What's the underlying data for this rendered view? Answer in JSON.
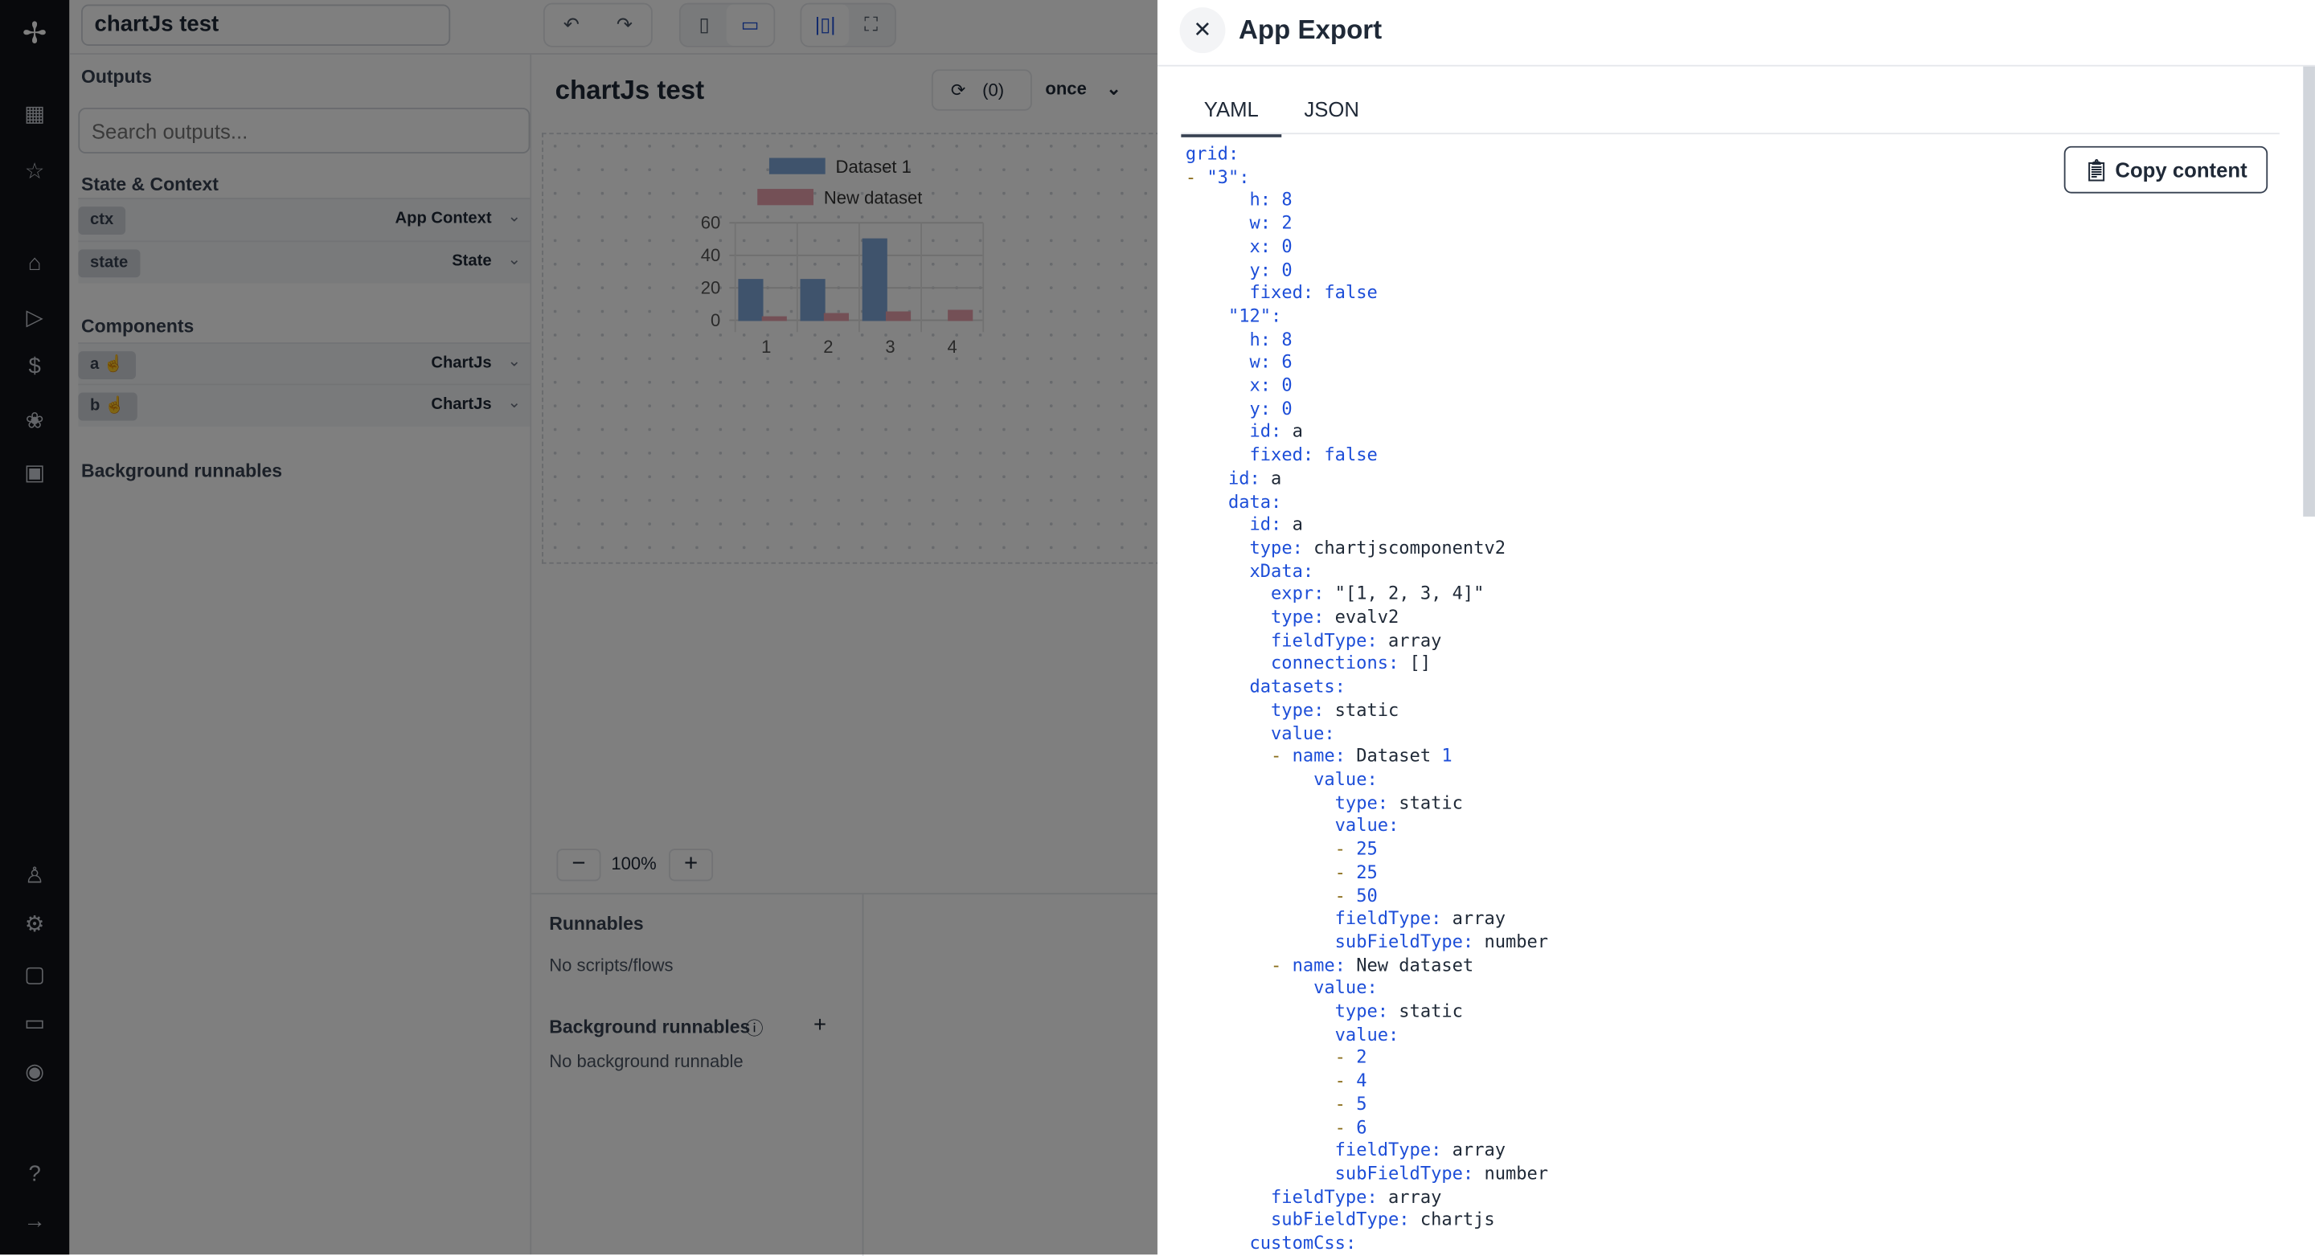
{
  "sidebar": {
    "icons": [
      "windmill-logo-icon",
      "apps-icon",
      "star-icon",
      "home-icon",
      "play-icon",
      "dollar-icon",
      "resources-icon",
      "calendar-icon",
      "user-icon",
      "gear-icon",
      "bot-icon",
      "folder-icon",
      "eye-icon",
      "help-icon",
      "arrow-right-icon"
    ]
  },
  "topbar": {
    "app_name": "chartJs test"
  },
  "outputs": {
    "title": "Outputs",
    "search_placeholder": "Search outputs...",
    "state_title": "State & Context",
    "state_rows": [
      {
        "chip": "ctx",
        "label": "App Context"
      },
      {
        "chip": "state",
        "label": "State"
      }
    ],
    "components_title": "Components",
    "components": [
      {
        "chip": "a",
        "label": "ChartJs"
      },
      {
        "chip": "b",
        "label": "ChartJs"
      }
    ],
    "bg_title": "Background runnables"
  },
  "center": {
    "title": "chartJs test",
    "refresh_count": "(0)",
    "refresh_mode": "once",
    "zoom": "100%"
  },
  "bottom": {
    "runnables_title": "Runnables",
    "runnables_empty": "No scripts/flows",
    "bg_title": "Background runnables",
    "bg_empty": "No background runnable"
  },
  "chart_data": {
    "type": "bar",
    "categories": [
      "1",
      "2",
      "3",
      "4"
    ],
    "series": [
      {
        "name": "Dataset 1",
        "values": [
          25,
          25,
          50,
          null
        ],
        "color": "#7ea6d8"
      },
      {
        "name": "New dataset",
        "values": [
          2,
          4,
          5,
          6
        ],
        "color": "#e8a0ad"
      }
    ],
    "ylim": [
      0,
      60
    ],
    "yticks": [
      0,
      20,
      40,
      60
    ],
    "legend": "top",
    "grid": true
  },
  "drawer": {
    "title": "App Export",
    "tabs": [
      "YAML",
      "JSON"
    ],
    "active_tab": "YAML",
    "copy_label": "Copy content",
    "lines": [
      {
        "i": 0,
        "k": "grid"
      },
      {
        "i": 2,
        "dash": true,
        "k": "\"3\""
      },
      {
        "i": 6,
        "k": "h",
        "v": "8",
        "t": "n"
      },
      {
        "i": 6,
        "k": "w",
        "v": "2",
        "t": "n"
      },
      {
        "i": 6,
        "k": "x",
        "v": "0",
        "t": "n"
      },
      {
        "i": 6,
        "k": "y",
        "v": "0",
        "t": "n"
      },
      {
        "i": 6,
        "k": "fixed",
        "v": "false",
        "t": "n"
      },
      {
        "i": 4,
        "k": "\"12\""
      },
      {
        "i": 6,
        "k": "h",
        "v": "8",
        "t": "n"
      },
      {
        "i": 6,
        "k": "w",
        "v": "6",
        "t": "n"
      },
      {
        "i": 6,
        "k": "x",
        "v": "0",
        "t": "n"
      },
      {
        "i": 6,
        "k": "y",
        "v": "0",
        "t": "n"
      },
      {
        "i": 6,
        "k": "id",
        "v": "a",
        "t": "s"
      },
      {
        "i": 6,
        "k": "fixed",
        "v": "false",
        "t": "n"
      },
      {
        "i": 4,
        "k": "id",
        "v": "a",
        "t": "s"
      },
      {
        "i": 4,
        "k": "data"
      },
      {
        "i": 6,
        "k": "id",
        "v": "a",
        "t": "s"
      },
      {
        "i": 6,
        "k": "type",
        "v": "chartjscomponentv2",
        "t": "s"
      },
      {
        "i": 6,
        "k": "xData"
      },
      {
        "i": 8,
        "k": "expr",
        "v": "\"[1, 2, 3, 4]\"",
        "t": "s"
      },
      {
        "i": 8,
        "k": "type",
        "v": "evalv2",
        "t": "s"
      },
      {
        "i": 8,
        "k": "fieldType",
        "v": "array",
        "t": "s"
      },
      {
        "i": 8,
        "k": "connections",
        "v": "[]",
        "t": "s"
      },
      {
        "i": 6,
        "k": "datasets"
      },
      {
        "i": 8,
        "k": "type",
        "v": "static",
        "t": "s"
      },
      {
        "i": 8,
        "k": "value"
      },
      {
        "i": 10,
        "dash": true,
        "k": "name",
        "v": "Dataset ",
        "t": "s",
        "v2": "1"
      },
      {
        "i": 12,
        "k": "value"
      },
      {
        "i": 14,
        "k": "type",
        "v": "static",
        "t": "s"
      },
      {
        "i": 14,
        "k": "value"
      },
      {
        "i": 16,
        "dash": true,
        "v": "25",
        "t": "n"
      },
      {
        "i": 16,
        "dash": true,
        "v": "25",
        "t": "n"
      },
      {
        "i": 16,
        "dash": true,
        "v": "50",
        "t": "n"
      },
      {
        "i": 14,
        "k": "fieldType",
        "v": "array",
        "t": "s"
      },
      {
        "i": 14,
        "k": "subFieldType",
        "v": "number",
        "t": "s"
      },
      {
        "i": 10,
        "dash": true,
        "k": "name",
        "v": "New dataset",
        "t": "s"
      },
      {
        "i": 12,
        "k": "value"
      },
      {
        "i": 14,
        "k": "type",
        "v": "static",
        "t": "s"
      },
      {
        "i": 14,
        "k": "value"
      },
      {
        "i": 16,
        "dash": true,
        "v": "2",
        "t": "n"
      },
      {
        "i": 16,
        "dash": true,
        "v": "4",
        "t": "n"
      },
      {
        "i": 16,
        "dash": true,
        "v": "5",
        "t": "n"
      },
      {
        "i": 16,
        "dash": true,
        "v": "6",
        "t": "n"
      },
      {
        "i": 14,
        "k": "fieldType",
        "v": "array",
        "t": "s"
      },
      {
        "i": 14,
        "k": "subFieldType",
        "v": "number",
        "t": "s"
      },
      {
        "i": 8,
        "k": "fieldType",
        "v": "array",
        "t": "s"
      },
      {
        "i": 8,
        "k": "subFieldType",
        "v": "chartjs",
        "t": "s"
      },
      {
        "i": 6,
        "k": "customCss"
      }
    ]
  }
}
